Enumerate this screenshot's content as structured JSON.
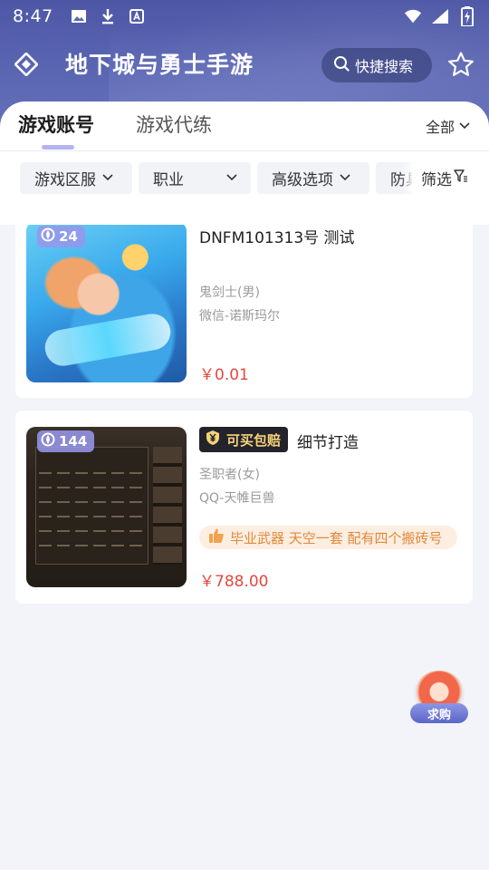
{
  "status_bar": {
    "time": "8:47",
    "left_icons": [
      "image-icon",
      "download-icon",
      "a-letter-icon"
    ],
    "right_icons": [
      "wifi-icon",
      "signal-icon",
      "battery-charging-icon"
    ]
  },
  "header": {
    "title": "地下城与勇士手游",
    "search_label": "快捷搜索"
  },
  "tabs": [
    {
      "label": "游戏账号",
      "active": true
    },
    {
      "label": "游戏代练",
      "active": false
    }
  ],
  "all_select": {
    "label": "全部"
  },
  "filters": [
    {
      "label": "游戏区服"
    },
    {
      "label": "职业"
    },
    {
      "label": "高级选项"
    },
    {
      "label": "防具"
    }
  ],
  "filter_button": {
    "label": "筛选"
  },
  "listings": [
    {
      "level": "24",
      "title": "DNFM101313号 测试",
      "class": "鬼剑士(男)",
      "server": "微信-诺斯玛尔",
      "price": "￥0.01"
    },
    {
      "level": "144",
      "guarantee": "可买包赔",
      "title": "细节打造",
      "class": "圣职者(女)",
      "server": "QQ-天帷巨兽",
      "highlight": "毕业武器 天空一套 配有四个搬砖号",
      "price": "￥788.00"
    }
  ],
  "float_button": {
    "label": "求购"
  },
  "colors": {
    "header_bg": "#5b66b3",
    "price": "#e5483e",
    "tab_underline": "#b4b4f0",
    "guarantee_bg": "#23232b",
    "guarantee_text": "#f6d27a",
    "highlight_bg": "#fdeee2",
    "highlight_text": "#e08a3c"
  }
}
